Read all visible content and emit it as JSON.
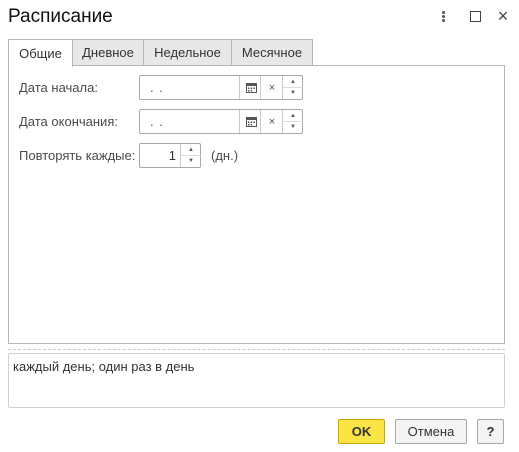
{
  "window": {
    "title": "Расписание"
  },
  "tabs": [
    {
      "label": "Общие",
      "active": true
    },
    {
      "label": "Дневное",
      "active": false
    },
    {
      "label": "Недельное",
      "active": false
    },
    {
      "label": "Месячное",
      "active": false
    }
  ],
  "general": {
    "start_date_label": "Дата начала:",
    "start_date_value": ".  .",
    "end_date_label": "Дата окончания:",
    "end_date_value": ".  .",
    "repeat_label": "Повторять каждые:",
    "repeat_value": "1",
    "repeat_unit": "(дн.)"
  },
  "description": {
    "text": "каждый день; один раз в день"
  },
  "buttons": {
    "ok": "OK",
    "cancel": "Отмена",
    "help": "?"
  },
  "icons": {
    "clear": "×",
    "spin_up": "▲",
    "spin_down": "▼",
    "close": "×"
  },
  "colors": {
    "ok_button": "#fbe446",
    "tab_inactive": "#e8e8e8",
    "border": "#b6b6b6"
  }
}
